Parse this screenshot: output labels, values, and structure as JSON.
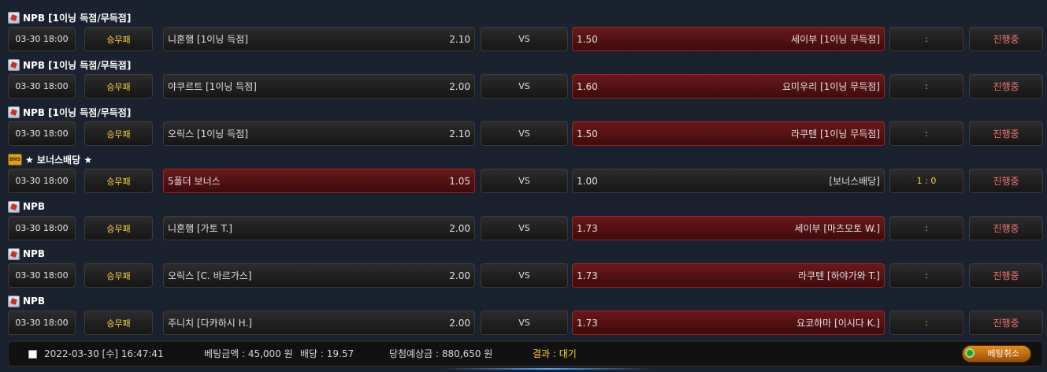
{
  "games": [
    {
      "league": "NPB [1이닝 득점/무득점]",
      "icon": "npb-icon",
      "date": "03-30 18:00",
      "type": "승무패",
      "home": "니혼햄 [1이닝 득점]",
      "home_odds": "2.10",
      "vs": "VS",
      "away_odds": "1.50",
      "away": "세이부 [1이닝 무득점]",
      "score": ":",
      "status": "진행중",
      "selected": "away"
    },
    {
      "league": "NPB [1이닝 득점/무득점]",
      "icon": "npb-icon",
      "date": "03-30 18:00",
      "type": "승무패",
      "home": "야쿠르트 [1이닝 득점]",
      "home_odds": "2.00",
      "vs": "VS",
      "away_odds": "1.60",
      "away": "요미우리 [1이닝 무득점]",
      "score": ":",
      "status": "진행중",
      "selected": "away"
    },
    {
      "league": "NPB [1이닝 득점/무득점]",
      "icon": "npb-icon",
      "date": "03-30 18:00",
      "type": "승무패",
      "home": "오릭스 [1이닝 득점]",
      "home_odds": "2.10",
      "vs": "VS",
      "away_odds": "1.50",
      "away": "라쿠텐 [1이닝 무득점]",
      "score": ":",
      "status": "진행중",
      "selected": "away"
    },
    {
      "league": "★ 보너스배당 ★",
      "icon": "bonus-icon",
      "date": "03-30 18:00",
      "type": "승무패",
      "home": "5폴더 보너스",
      "home_odds": "1.05",
      "vs": "VS",
      "away_odds": "1.00",
      "away": "[보너스배당]",
      "score": "1 : 0",
      "status": "진행중",
      "selected": "home"
    },
    {
      "league": "NPB",
      "icon": "npb-icon",
      "date": "03-30 18:00",
      "type": "승무패",
      "home": "니혼햄 [가토 T.]",
      "home_odds": "2.00",
      "vs": "VS",
      "away_odds": "1.73",
      "away": "세이부 [마츠모토 W.]",
      "score": ":",
      "status": "진행중",
      "selected": "away"
    },
    {
      "league": "NPB",
      "icon": "npb-icon",
      "date": "03-30 18:00",
      "type": "승무패",
      "home": "오릭스 [C. 바르가스]",
      "home_odds": "2.00",
      "vs": "VS",
      "away_odds": "1.73",
      "away": "라쿠텐 [하야가와 T.]",
      "score": ":",
      "status": "진행중",
      "selected": "away"
    },
    {
      "league": "NPB",
      "icon": "npb-icon",
      "date": "03-30 18:00",
      "type": "승무패",
      "home": "주니치 [다카하시 H.]",
      "home_odds": "2.00",
      "vs": "VS",
      "away_odds": "1.73",
      "away": "요코하마 [이시다 K.]",
      "score": ":",
      "status": "진행중",
      "selected": "away"
    }
  ],
  "footer": {
    "datetime": "2022-03-30 [수] 16:47:41",
    "bet_amount": "베팅금액 : 45,000 원",
    "odds": "배당 : 19.57",
    "expected": "당첨예상금 : 880,650 원",
    "result": "결과 : 대기",
    "cancel": "베팅취소"
  },
  "colors": {
    "selected": "#5a1414",
    "accent": "#ffd23c",
    "status": "#ff7070"
  }
}
